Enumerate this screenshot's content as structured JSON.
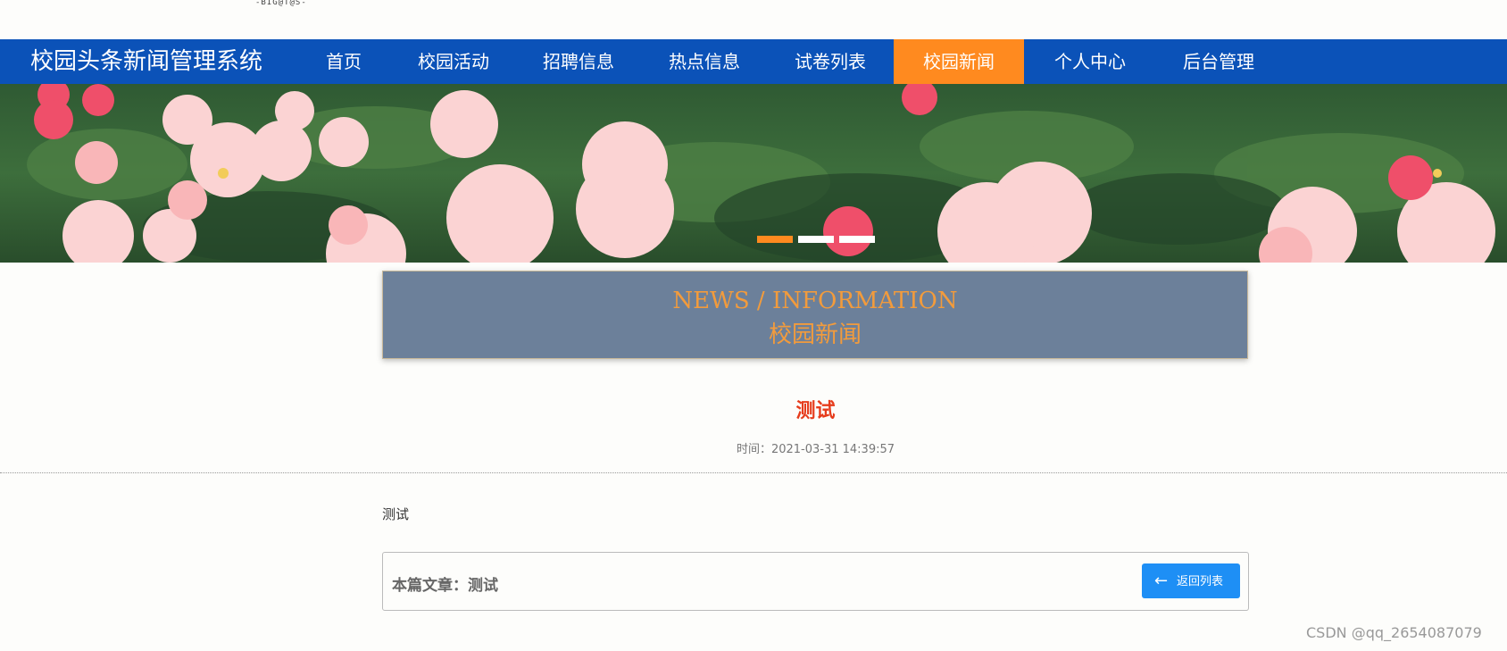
{
  "header": {
    "logo_text": "-BIG@T@S-"
  },
  "navbar": {
    "brand": "校园头条新闻管理系统",
    "items": [
      {
        "label": "首页"
      },
      {
        "label": "校园活动"
      },
      {
        "label": "招聘信息"
      },
      {
        "label": "热点信息"
      },
      {
        "label": "试卷列表"
      },
      {
        "label": "校园新闻",
        "active": true
      },
      {
        "label": "个人中心"
      },
      {
        "label": "后台管理"
      }
    ]
  },
  "banner": {
    "slides": 3,
    "active_slide": 1
  },
  "section": {
    "title_en": "NEWS / INFORMATION",
    "title_cn": "校园新闻"
  },
  "article": {
    "title": "测试",
    "time": "时间：2021-03-31 14:39:57",
    "body": "测试"
  },
  "footer": {
    "current_label": "本篇文章：测试",
    "back_label": "返回列表"
  },
  "watermark": "CSDN @qq_2654087079",
  "colors": {
    "nav_bg": "#0b52b8",
    "nav_active": "#ff8a1f",
    "title_accent": "#f29b3c",
    "article_title": "#e63c1c",
    "button": "#1e8ff5"
  }
}
